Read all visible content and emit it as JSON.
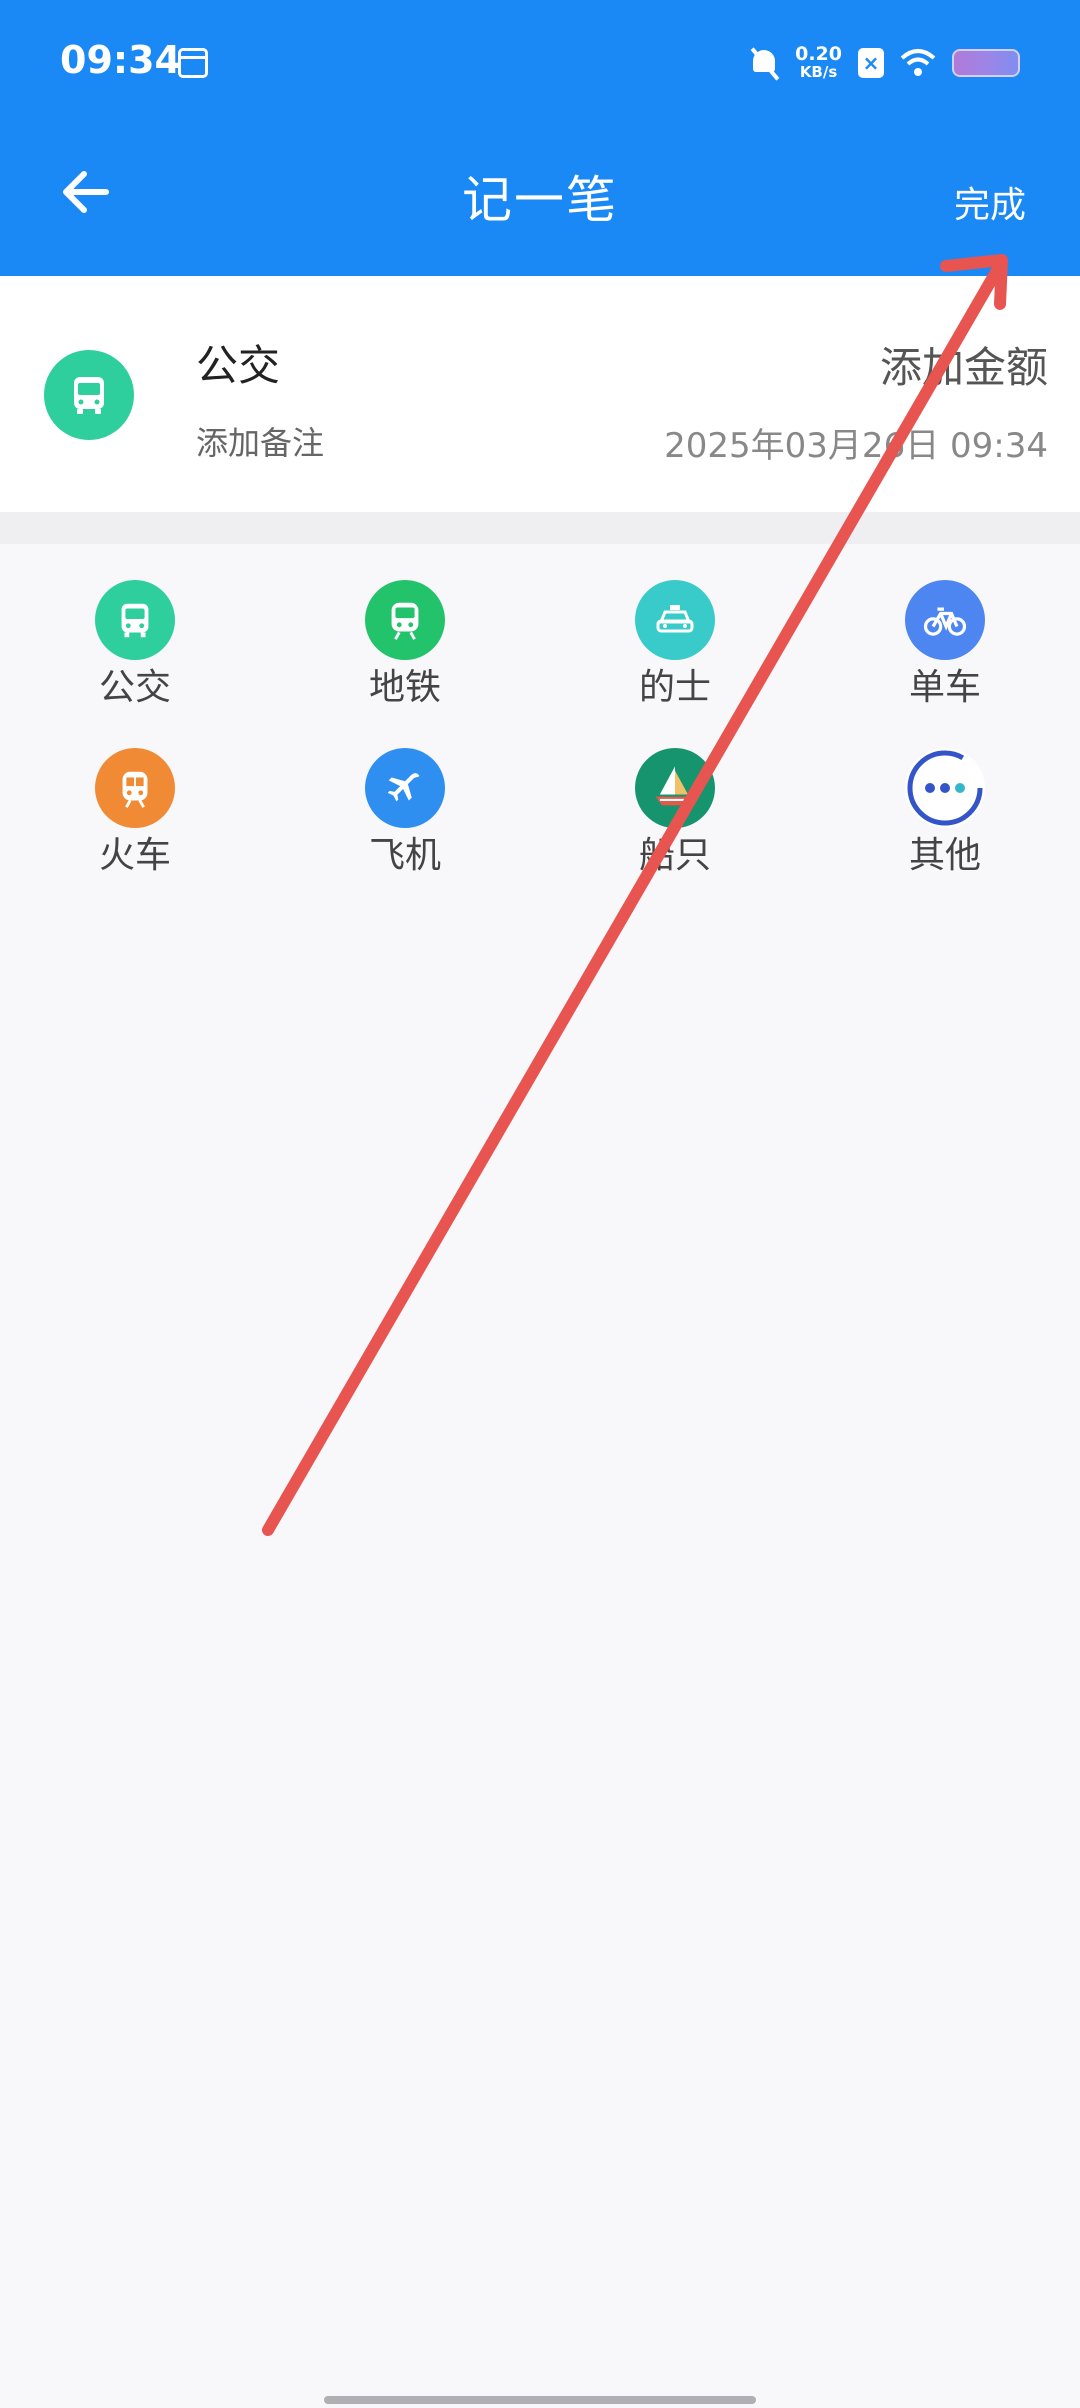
{
  "status_bar": {
    "time": "09:34",
    "net_speed_value": "0.20",
    "net_speed_unit": "KB/s",
    "icons": [
      "calendar-icon",
      "bell-off-icon",
      "x-badge-icon",
      "wifi-icon",
      "battery-icon"
    ]
  },
  "header": {
    "title": "记一笔",
    "done_label": "完成",
    "back_icon": "arrow-left-icon",
    "background_color": "#1a88f5"
  },
  "entry": {
    "category": "公交",
    "note_placeholder": "添加备注",
    "amount_placeholder": "添加金额",
    "datetime": "2025年03月26日 09:34",
    "icon": "bus-icon",
    "icon_color": "#2ecf9c"
  },
  "categories": [
    {
      "label": "公交",
      "icon": "bus-icon",
      "color": "#2ecf9c"
    },
    {
      "label": "地铁",
      "icon": "subway-icon",
      "color": "#22c36a"
    },
    {
      "label": "的士",
      "icon": "taxi-icon",
      "color": "#39cbc9"
    },
    {
      "label": "单车",
      "icon": "bicycle-icon",
      "color": "#4d86f0"
    },
    {
      "label": "火车",
      "icon": "train-icon",
      "color": "#f08a35"
    },
    {
      "label": "飞机",
      "icon": "airplane-icon",
      "color": "#2f8ff0"
    },
    {
      "label": "船只",
      "icon": "ship-icon",
      "color": "#16946e"
    },
    {
      "label": "其他",
      "icon": "more-icon",
      "color": "#ffffff"
    }
  ],
  "annotation": {
    "type": "arrow",
    "color": "#e85450",
    "points_to": "done-button"
  }
}
